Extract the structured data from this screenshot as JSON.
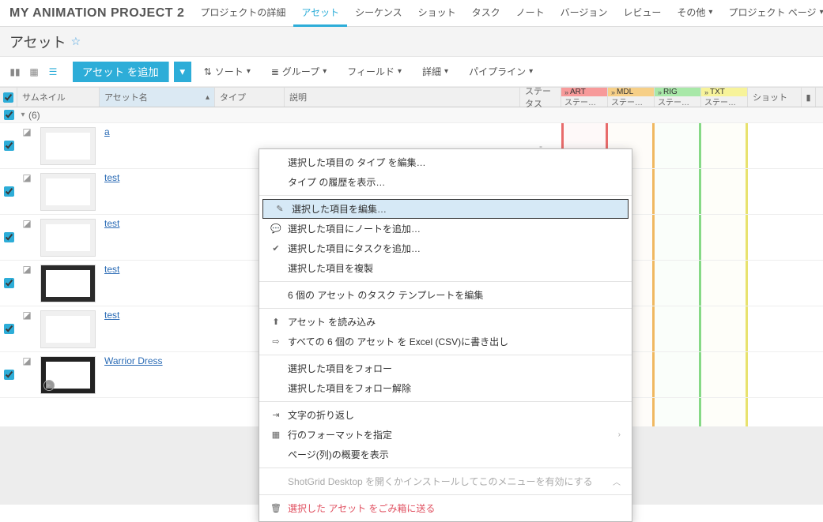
{
  "project_title": "MY ANIMATION PROJECT 2",
  "nav": {
    "items": [
      "プロジェクトの詳細",
      "アセット",
      "シーケンス",
      "ショット",
      "タスク",
      "ノート",
      "バージョン",
      "レビュー"
    ],
    "other": "その他",
    "project_page": "プロジェクト ページ",
    "active_index": 1
  },
  "page_title": "アセット",
  "toolbar": {
    "add_asset": "アセット を追加",
    "sort": "ソート",
    "group": "グループ",
    "fields": "フィールド",
    "details": "詳細",
    "pipeline": "パイプライン"
  },
  "columns": {
    "thumbnail": "サムネイル",
    "asset_name": "アセット名",
    "type": "タイプ",
    "desc": "説明",
    "status": "ステータス",
    "shot": "ショット"
  },
  "pipeline_steps": [
    {
      "code": "ART",
      "status": "ステー…"
    },
    {
      "code": "MDL",
      "status": "ステー…"
    },
    {
      "code": "RIG",
      "status": "ステー…"
    },
    {
      "code": "TXT",
      "status": "ステー…"
    }
  ],
  "group_count": "(6)",
  "assets": [
    {
      "name": "a",
      "status": "-",
      "thumb": "light"
    },
    {
      "name": "test",
      "status": "",
      "thumb": "light"
    },
    {
      "name": "test",
      "status": "",
      "thumb": "light"
    },
    {
      "name": "test",
      "status": "",
      "thumb": "dark"
    },
    {
      "name": "test",
      "status": "",
      "thumb": "light"
    },
    {
      "name": "Warrior Dress",
      "status": "",
      "thumb": "dark2"
    }
  ],
  "context_menu": {
    "edit_type": "選択した項目の タイプ を編集…",
    "type_history": "タイプ の履歴を表示…",
    "edit_selected": "選択した項目を編集…",
    "add_note": "選択した項目にノートを追加…",
    "add_task": "選択した項目にタスクを追加…",
    "duplicate": "選択した項目を複製",
    "edit_templates": "6 個の アセット のタスク テンプレートを編集",
    "import": "アセット を読み込み",
    "export_csv": "すべての 6 個の アセット を Excel (CSV)に書き出し",
    "follow": "選択した項目をフォロー",
    "unfollow": "選択した項目をフォロー解除",
    "wrap": "文字の折り返し",
    "row_format": "行のフォーマットを指定",
    "page_overview": "ページ(列)の概要を表示",
    "desktop": "ShotGrid Desktop を開くかインストールしてこのメニューを有効にする",
    "trash": "選択した アセット をごみ箱に送る"
  }
}
